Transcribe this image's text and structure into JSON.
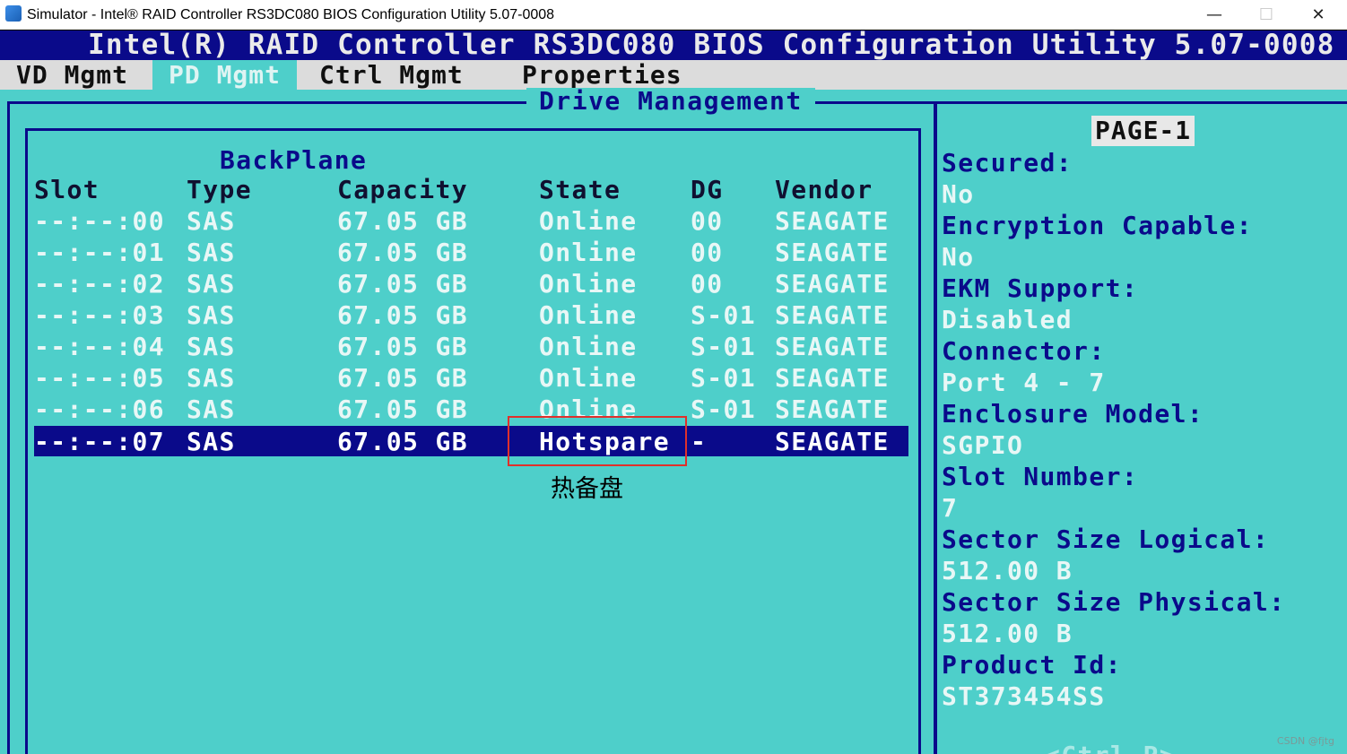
{
  "window": {
    "title": "Simulator - Intel® RAID Controller RS3DC080 BIOS Configuration Utility 5.07-0008",
    "controls": {
      "minimize": "—",
      "maximize": "☐",
      "close": "✕"
    }
  },
  "bios": {
    "title": "Intel(R) RAID Controller RS3DC080 BIOS Configuration Utility 5.07-0008",
    "menu": [
      {
        "label": "VD Mgmt",
        "active": false
      },
      {
        "label": "PD Mgmt",
        "active": true
      },
      {
        "label": "Ctrl Mgmt",
        "active": false
      },
      {
        "label": "Properties",
        "active": false
      }
    ]
  },
  "drive_panel": {
    "caption": "Drive Management",
    "group_label": "BackPlane",
    "columns": [
      "Slot",
      "Type",
      "Capacity",
      "State",
      "DG",
      "Vendor"
    ],
    "rows": [
      {
        "slot": "--:--:00",
        "type": "SAS",
        "capacity": "67.05 GB",
        "state": "Online",
        "dg": "00",
        "vendor": "SEAGATE"
      },
      {
        "slot": "--:--:01",
        "type": "SAS",
        "capacity": "67.05 GB",
        "state": "Online",
        "dg": "00",
        "vendor": "SEAGATE"
      },
      {
        "slot": "--:--:02",
        "type": "SAS",
        "capacity": "67.05 GB",
        "state": "Online",
        "dg": "00",
        "vendor": "SEAGATE"
      },
      {
        "slot": "--:--:03",
        "type": "SAS",
        "capacity": "67.05 GB",
        "state": "Online",
        "dg": "S-01",
        "vendor": "SEAGATE"
      },
      {
        "slot": "--:--:04",
        "type": "SAS",
        "capacity": "67.05 GB",
        "state": "Online",
        "dg": "S-01",
        "vendor": "SEAGATE"
      },
      {
        "slot": "--:--:05",
        "type": "SAS",
        "capacity": "67.05 GB",
        "state": "Online",
        "dg": "S-01",
        "vendor": "SEAGATE"
      },
      {
        "slot": "--:--:06",
        "type": "SAS",
        "capacity": "67.05 GB",
        "state": "Online",
        "dg": "S-01",
        "vendor": "SEAGATE"
      }
    ],
    "selected_row": {
      "slot": "--:--:07",
      "type": "SAS",
      "capacity": "67.05 GB",
      "state": "Hotspare",
      "dg": "-",
      "vendor": "SEAGATE"
    },
    "annotation": "热备盘"
  },
  "properties_panel": {
    "page": "PAGE-1",
    "items": [
      {
        "label": "Secured:",
        "value": "No"
      },
      {
        "label": "Encryption Capable:",
        "value": "No"
      },
      {
        "label": "EKM Support:",
        "value": "Disabled"
      },
      {
        "label": "Connector:",
        "value": "Port 4 - 7"
      },
      {
        "label": "Enclosure Model:",
        "value": "SGPIO"
      },
      {
        "label": "Slot Number:",
        "value": "7"
      },
      {
        "label": "Sector Size Logical:",
        "value": "512.00 B"
      },
      {
        "label": "Sector Size Physical:",
        "value": "512.00 B"
      },
      {
        "label": "Product Id:",
        "value": "ST373454SS"
      }
    ],
    "footer_partial": "<Ctrl-P>"
  },
  "watermark": "CSDN @fjtg",
  "colors": {
    "screen_bg": "#4ecfca",
    "bios_blue": "#0a0a8a",
    "menu_bg": "#dcdcdc",
    "highlight_box": "#e0302b"
  }
}
